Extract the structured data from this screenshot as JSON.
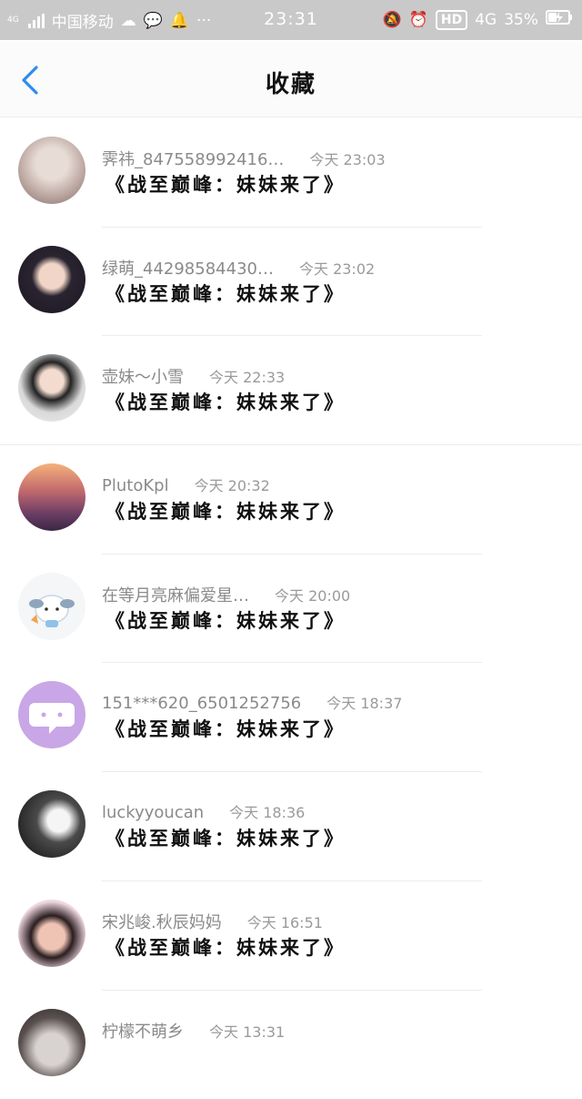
{
  "status_bar": {
    "network_small": "4G",
    "carrier": "中国移动",
    "time": "23:31",
    "hd_badge": "HD",
    "network": "4G",
    "battery": "35%"
  },
  "header": {
    "title": "收藏"
  },
  "items": [
    {
      "name": "霁祎_847558992416…",
      "time": "今天 23:03",
      "content": "《战至巅峰：妹妹来了》"
    },
    {
      "name": "绿萌_44298584430…",
      "time": "今天 23:02",
      "content": "《战至巅峰：妹妹来了》"
    },
    {
      "name": "壶妹～小雪",
      "time": "今天 22:33",
      "content": "《战至巅峰：妹妹来了》"
    },
    {
      "name": "PlutoKpl",
      "time": "今天 20:32",
      "content": "《战至巅峰：妹妹来了》"
    },
    {
      "name": "在等月亮麻偏爱星…",
      "time": "今天 20:00",
      "content": "《战至巅峰：妹妹来了》"
    },
    {
      "name": "151***620_6501252756",
      "time": "今天 18:37",
      "content": "《战至巅峰：妹妹来了》"
    },
    {
      "name": "luckyyoucan",
      "time": "今天 18:36",
      "content": "《战至巅峰：妹妹来了》"
    },
    {
      "name": "宋兆峻.秋辰妈妈",
      "time": "今天 16:51",
      "content": "《战至巅峰：妹妹来了》"
    },
    {
      "name": "柠檬不萌乡",
      "time": "今天 13:31",
      "content": ""
    }
  ]
}
